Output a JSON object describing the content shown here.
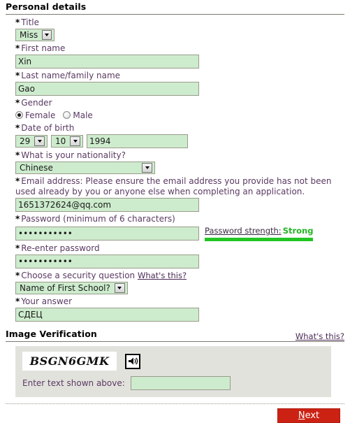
{
  "sections": {
    "personal": {
      "heading": "Personal details"
    },
    "verification": {
      "heading": "Image Verification",
      "whats_this": "What's this?"
    }
  },
  "required_marker": "*",
  "fields": {
    "title": {
      "label": "Title",
      "value": "Miss"
    },
    "first_name": {
      "label": "First name",
      "value": "Xin"
    },
    "last_name": {
      "label": "Last name/family name",
      "value": "Gao"
    },
    "gender": {
      "label": "Gender",
      "options": [
        {
          "label": "Female",
          "selected": true
        },
        {
          "label": "Male",
          "selected": false
        }
      ]
    },
    "dob": {
      "label": "Date of birth",
      "day": "29",
      "month": "10",
      "year": "1994"
    },
    "nationality": {
      "label": "What is your nationality?",
      "value": "Chinese"
    },
    "email": {
      "label": "Email address: Please ensure the email address you provide has not been used already by you or anyone else when completing an application.",
      "value": "1651372624@qq.com"
    },
    "password": {
      "label": "Password (minimum of 6 characters)",
      "value": "•••••••••••",
      "strength_label": "Password strength:",
      "strength_value": "Strong",
      "strength_color": "#22b522"
    },
    "reenter_password": {
      "label": "Re-enter password",
      "value": "•••••••••••"
    },
    "security_question": {
      "label": "Choose a security question",
      "whats_this": "What's this?",
      "value": "Name of First School?"
    },
    "security_answer": {
      "label": "Your answer",
      "value": "СДЕЦ"
    }
  },
  "verification": {
    "captcha_text": "BSGN6GMK",
    "audio_icon": "speaker-icon",
    "entry_label": "Enter text shown above:",
    "entry_value": "",
    "entry_placeholder": ""
  },
  "footer": {
    "next_label_prefix": "N",
    "next_label_rest": "ext",
    "next_color": "#cc2214"
  }
}
